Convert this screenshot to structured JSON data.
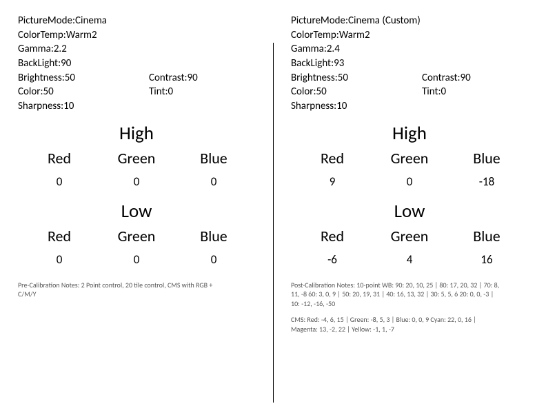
{
  "labels": {
    "pictureMode": "PictureMode",
    "colorTemp": "ColorTemp",
    "gamma": "Gamma",
    "backlight": "BackLight",
    "brightness": "Brightness",
    "contrast": "Contrast",
    "color": "Color",
    "tint": "Tint",
    "sharpness": "Sharpness",
    "high": "High",
    "low": "Low",
    "red": "Red",
    "green": "Green",
    "blue": "Blue"
  },
  "left": {
    "settings": {
      "pictureMode": "Cinema",
      "colorTemp": "Warm2",
      "gamma": "2.2",
      "backlight": "90",
      "brightness": "50",
      "contrast": "90",
      "color": "50",
      "tint": "0",
      "sharpness": "10"
    },
    "high": {
      "red": "0",
      "green": "0",
      "blue": "0"
    },
    "low": {
      "red": "0",
      "green": "0",
      "blue": "0"
    },
    "notes": "Pre-Calibration Notes: 2 Point control, 20 tile control, CMS with RGB + C/M/Y"
  },
  "right": {
    "settings": {
      "pictureMode": "Cinema (Custom)",
      "colorTemp": "Warm2",
      "gamma": "2.4",
      "backlight": "93",
      "brightness": "50",
      "contrast": "90",
      "color": "50",
      "tint": "0",
      "sharpness": "10"
    },
    "high": {
      "red": "9",
      "green": "0",
      "blue": "-18"
    },
    "low": {
      "red": "-6",
      "green": "4",
      "blue": "16"
    },
    "notes1": "Post-Calibration Notes: 10-point WB: 90: 20, 10, 25 | 80: 17, 20, 32 | 70: 8, 11, -8\n60: 3, 0, 9 | 50: 20, 19, 31 | 40: 16, 13, 32 | 30: 5, 5, 6\n20: 0, 0, -3 | 10: -12, -16, -50",
    "notes2": "CMS: Red: -4, 6, 15 | Green: -8, 5, 3 | Blue: 0, 0, 9\nCyan: 22, 0, 16 | Magenta: 13, -2, 22 | Yellow: -1, 1, -7"
  }
}
